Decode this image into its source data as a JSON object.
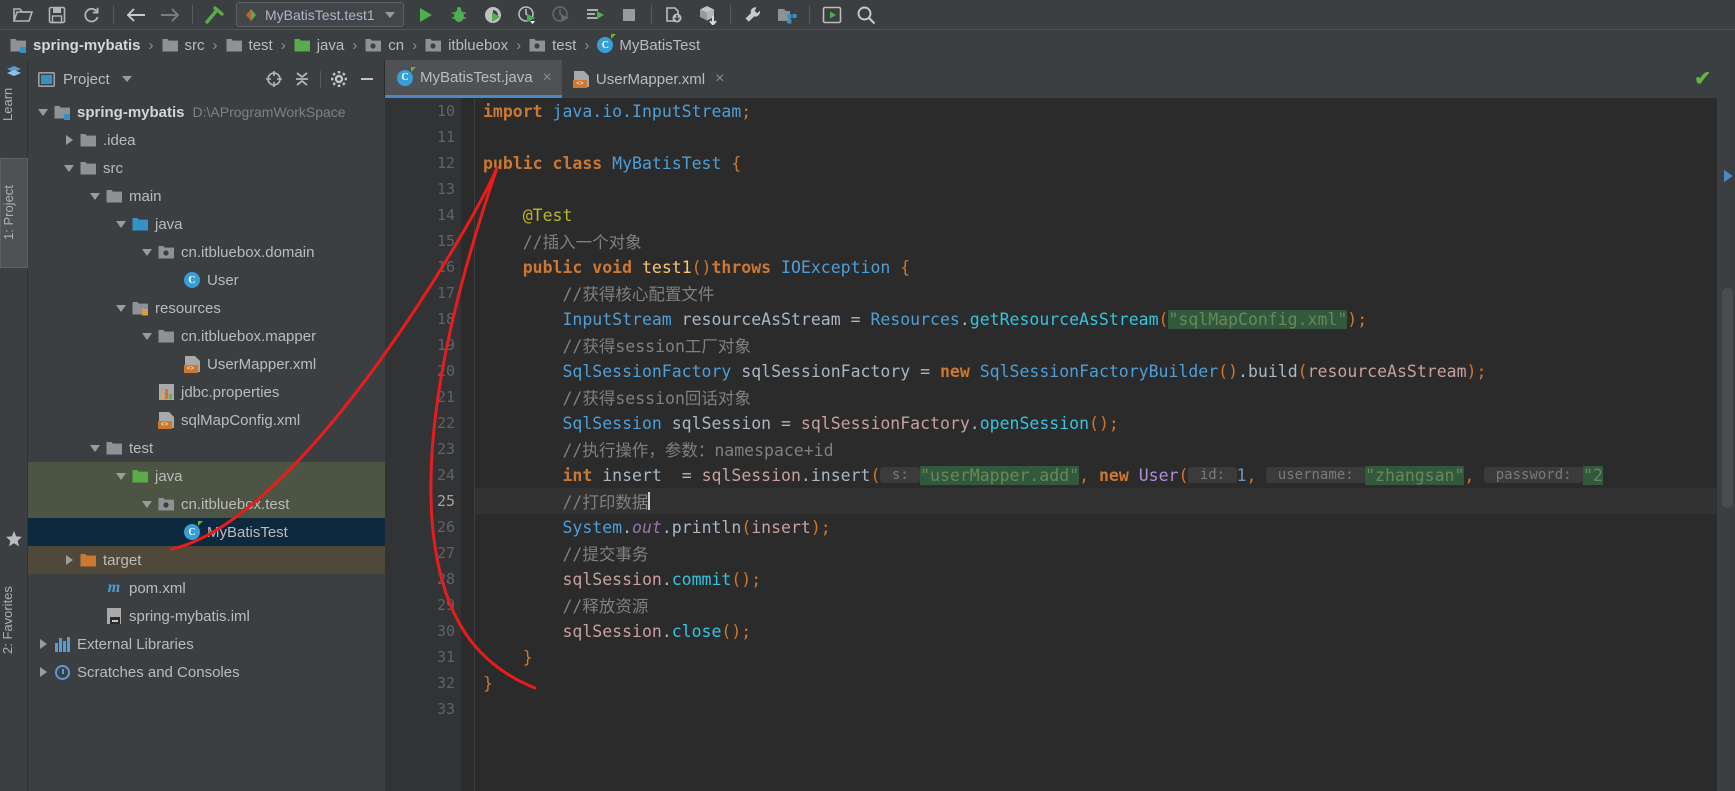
{
  "toolbar": {
    "icons": [
      {
        "name": "open-folder-icon",
        "glyph": "folder-open"
      },
      {
        "name": "save-all-icon",
        "glyph": "floppy"
      },
      {
        "name": "sync-icon",
        "glyph": "refresh"
      },
      {
        "name": "back-icon",
        "glyph": "arrow-left"
      },
      {
        "name": "forward-icon",
        "glyph": "arrow-right"
      },
      {
        "name": "build-hammer-icon",
        "glyph": "hammer"
      }
    ],
    "run_configuration": "MyBatisTest.test1",
    "right_icons": [
      {
        "name": "run-icon",
        "glyph": "play"
      },
      {
        "name": "debug-icon",
        "glyph": "bug"
      },
      {
        "name": "run-with-coverage-icon",
        "glyph": "coverage"
      },
      {
        "name": "profile-icon",
        "glyph": "profiler"
      },
      {
        "name": "attach-profiler-icon",
        "glyph": "profiler-disabled"
      },
      {
        "name": "run-dashboard-icon",
        "glyph": "list-run"
      },
      {
        "name": "stop-icon",
        "glyph": "stop"
      },
      {
        "name": "update-project-icon",
        "glyph": "vcs-update"
      },
      {
        "name": "commit-icon",
        "glyph": "vcs-commit"
      },
      {
        "name": "settings-wrench-icon",
        "glyph": "wrench"
      },
      {
        "name": "project-structure-icon",
        "glyph": "structure"
      },
      {
        "name": "run-anything-icon",
        "glyph": "play-box"
      },
      {
        "name": "search-everywhere-icon",
        "glyph": "magnifier"
      }
    ]
  },
  "breadcrumb": [
    {
      "label": "spring-mybatis",
      "icon": "module-folder-icon",
      "bold": true
    },
    {
      "label": "src",
      "icon": "folder-icon",
      "bold": false
    },
    {
      "label": "test",
      "icon": "folder-icon",
      "bold": false
    },
    {
      "label": "java",
      "icon": "source-root-folder-icon",
      "bold": false
    },
    {
      "label": "cn",
      "icon": "package-icon",
      "bold": false
    },
    {
      "label": "itbluebox",
      "icon": "package-icon",
      "bold": false
    },
    {
      "label": "test",
      "icon": "package-icon",
      "bold": false
    },
    {
      "label": "MyBatisTest",
      "icon": "test-class-icon",
      "bold": false
    }
  ],
  "left_strip": {
    "learn": "Learn",
    "project": "1: Project",
    "favorites": "2: Favorites"
  },
  "project_panel": {
    "title": "Project",
    "header_buttons": [
      {
        "name": "scroll-from-source-icon",
        "glyph": "target"
      },
      {
        "name": "collapse-all-icon",
        "glyph": "collapse"
      },
      {
        "name": "settings-gear-icon",
        "glyph": "gear"
      },
      {
        "name": "hide-panel-icon",
        "glyph": "minus"
      }
    ],
    "tree": [
      {
        "label": "spring-mybatis",
        "path": "D:\\AProgramWorkSpace",
        "indent": 0,
        "arrow": "down",
        "icon": "module-folder-icon",
        "bold": true,
        "selected": ""
      },
      {
        "label": ".idea",
        "path": "",
        "indent": 1,
        "arrow": "right",
        "icon": "folder-icon",
        "bold": false,
        "selected": ""
      },
      {
        "label": "src",
        "path": "",
        "indent": 1,
        "arrow": "down",
        "icon": "folder-icon",
        "bold": false,
        "selected": ""
      },
      {
        "label": "main",
        "path": "",
        "indent": 2,
        "arrow": "down",
        "icon": "folder-icon",
        "bold": false,
        "selected": ""
      },
      {
        "label": "java",
        "path": "",
        "indent": 3,
        "arrow": "down",
        "icon": "source-root-blue-icon",
        "bold": false,
        "selected": ""
      },
      {
        "label": "cn.itbluebox.domain",
        "path": "",
        "indent": 4,
        "arrow": "down",
        "icon": "package-icon",
        "bold": false,
        "selected": ""
      },
      {
        "label": "User",
        "path": "",
        "indent": 5,
        "arrow": "none",
        "icon": "class-icon",
        "bold": false,
        "selected": ""
      },
      {
        "label": "resources",
        "path": "",
        "indent": 3,
        "arrow": "down",
        "icon": "resource-root-folder-icon",
        "bold": false,
        "selected": ""
      },
      {
        "label": "cn.itbluebox.mapper",
        "path": "",
        "indent": 4,
        "arrow": "down",
        "icon": "folder-icon",
        "bold": false,
        "selected": ""
      },
      {
        "label": "UserMapper.xml",
        "path": "",
        "indent": 5,
        "arrow": "none",
        "icon": "xml-file-icon",
        "bold": false,
        "selected": ""
      },
      {
        "label": "jdbc.properties",
        "path": "",
        "indent": 4,
        "arrow": "none",
        "icon": "properties-file-icon",
        "bold": false,
        "selected": ""
      },
      {
        "label": "sqlMapConfig.xml",
        "path": "",
        "indent": 4,
        "arrow": "none",
        "icon": "xml-file-icon",
        "bold": false,
        "selected": ""
      },
      {
        "label": "test",
        "path": "",
        "indent": 2,
        "arrow": "down",
        "icon": "folder-icon",
        "bold": false,
        "selected": ""
      },
      {
        "label": "java",
        "path": "",
        "indent": 3,
        "arrow": "down",
        "icon": "test-source-root-icon",
        "bold": false,
        "selected": "green"
      },
      {
        "label": "cn.itbluebox.test",
        "path": "",
        "indent": 4,
        "arrow": "down",
        "icon": "package-icon",
        "bold": false,
        "selected": "green"
      },
      {
        "label": "MyBatisTest",
        "path": "",
        "indent": 5,
        "arrow": "none",
        "icon": "test-class-icon",
        "bold": false,
        "selected": "blue"
      },
      {
        "label": "target",
        "path": "",
        "indent": 1,
        "arrow": "right",
        "icon": "excluded-folder-icon",
        "bold": false,
        "selected": "olive"
      },
      {
        "label": "pom.xml",
        "path": "",
        "indent": 2,
        "arrow": "none",
        "icon": "maven-file-icon",
        "bold": false,
        "selected": ""
      },
      {
        "label": "spring-mybatis.iml",
        "path": "",
        "indent": 2,
        "arrow": "none",
        "icon": "iml-file-icon",
        "bold": false,
        "selected": ""
      },
      {
        "label": "External Libraries",
        "path": "",
        "indent": 0,
        "arrow": "right",
        "icon": "libraries-icon",
        "bold": false,
        "selected": ""
      },
      {
        "label": "Scratches and Consoles",
        "path": "",
        "indent": 0,
        "arrow": "right",
        "icon": "scratches-icon",
        "bold": false,
        "selected": ""
      }
    ]
  },
  "editor": {
    "tabs": [
      {
        "label": "MyBatisTest.java",
        "icon": "test-class-icon",
        "active": true,
        "close": "×"
      },
      {
        "label": "UserMapper.xml",
        "icon": "xml-file-icon",
        "active": false,
        "close": "×"
      }
    ],
    "first_line_number": 10,
    "current_line": 25,
    "line_numbers": [
      10,
      11,
      12,
      13,
      14,
      15,
      16,
      17,
      18,
      19,
      20,
      21,
      22,
      23,
      24,
      25,
      26,
      27,
      28,
      29,
      30,
      31,
      32,
      33
    ],
    "inspection_status": "✔",
    "code_lines": [
      {
        "n": 10,
        "tokens": [
          {
            "t": "import ",
            "c": "kw"
          },
          {
            "t": "java.io.InputStream",
            "c": "cls"
          },
          {
            "t": ";",
            "c": "sem"
          }
        ]
      },
      {
        "n": 11,
        "tokens": []
      },
      {
        "n": 12,
        "tokens": [
          {
            "t": "public ",
            "c": "kw"
          },
          {
            "t": "class ",
            "c": "kw"
          },
          {
            "t": "MyBatisTest",
            "c": "cls"
          },
          {
            "t": " ",
            "c": "op"
          },
          {
            "t": "{",
            "c": "sem"
          }
        ]
      },
      {
        "n": 13,
        "tokens": []
      },
      {
        "n": 14,
        "tokens": [
          {
            "t": "    @Test",
            "c": "ann"
          }
        ]
      },
      {
        "n": 15,
        "tokens": [
          {
            "t": "    //插入一个对象",
            "c": "cmt"
          }
        ]
      },
      {
        "n": 16,
        "tokens": [
          {
            "t": "    public ",
            "c": "kw"
          },
          {
            "t": "void ",
            "c": "kw"
          },
          {
            "t": "test1",
            "c": "methc"
          },
          {
            "t": "()",
            "c": "sem"
          },
          {
            "t": "throws ",
            "c": "kw"
          },
          {
            "t": "IOException",
            "c": "cls"
          },
          {
            "t": " ",
            "c": "op"
          },
          {
            "t": "{",
            "c": "sem"
          }
        ]
      },
      {
        "n": 17,
        "tokens": [
          {
            "t": "        //获得核心配置文件",
            "c": "cmt"
          }
        ]
      },
      {
        "n": 18,
        "tokens": [
          {
            "t": "        InputStream",
            "c": "cls"
          },
          {
            "t": " resourceAsStream ",
            "c": "var"
          },
          {
            "t": "= ",
            "c": "op"
          },
          {
            "t": "Resources",
            "c": "cls"
          },
          {
            "t": ".",
            "c": "op"
          },
          {
            "t": "getResourceAsStream",
            "c": "meth-i"
          },
          {
            "t": "(",
            "c": "sem"
          },
          {
            "t": "\"sqlMapConfig.xml\"",
            "c": "str-hl"
          },
          {
            "t": ")",
            "c": "sem"
          },
          {
            "t": ";",
            "c": "sem"
          }
        ]
      },
      {
        "n": 19,
        "tokens": [
          {
            "t": "        //获得session工厂对象",
            "c": "cmt"
          }
        ]
      },
      {
        "n": 20,
        "tokens": [
          {
            "t": "        SqlSessionFactory",
            "c": "cls"
          },
          {
            "t": " sqlSessionFactory ",
            "c": "var"
          },
          {
            "t": "= ",
            "c": "op"
          },
          {
            "t": "new ",
            "c": "kw"
          },
          {
            "t": "SqlSessionFactoryBuilder",
            "c": "cls"
          },
          {
            "t": "()",
            "c": "sem"
          },
          {
            "t": ".",
            "c": "op"
          },
          {
            "t": "build",
            "c": "meth"
          },
          {
            "t": "(",
            "c": "sem"
          },
          {
            "t": "resourceAsStream",
            "c": "param"
          },
          {
            "t": ")",
            "c": "sem"
          },
          {
            "t": ";",
            "c": "sem"
          }
        ]
      },
      {
        "n": 21,
        "tokens": [
          {
            "t": "        //获得session回话对象",
            "c": "cmt"
          }
        ]
      },
      {
        "n": 22,
        "tokens": [
          {
            "t": "        SqlSession",
            "c": "cls"
          },
          {
            "t": " sqlSession ",
            "c": "var"
          },
          {
            "t": "= ",
            "c": "op"
          },
          {
            "t": "sqlSessionFactory",
            "c": "param"
          },
          {
            "t": ".",
            "c": "op"
          },
          {
            "t": "openSession",
            "c": "meth-i"
          },
          {
            "t": "()",
            "c": "sem"
          },
          {
            "t": ";",
            "c": "sem"
          }
        ]
      },
      {
        "n": 23,
        "tokens": [
          {
            "t": "        //执行操作，参数：namespace+id",
            "c": "cmt"
          }
        ]
      },
      {
        "n": 24,
        "tokens": [
          {
            "t": "        int ",
            "c": "kw"
          },
          {
            "t": "insert  ",
            "c": "var"
          },
          {
            "t": "= ",
            "c": "op"
          },
          {
            "t": "sqlSession",
            "c": "param"
          },
          {
            "t": ".",
            "c": "op"
          },
          {
            "t": "insert",
            "c": "meth"
          },
          {
            "t": "(",
            "c": "sem"
          },
          {
            "t": " s: ",
            "c": "hint"
          },
          {
            "t": "\"userMapper.add\"",
            "c": "str-hl"
          },
          {
            "t": ", ",
            "c": "sem"
          },
          {
            "t": "new ",
            "c": "kw"
          },
          {
            "t": "User",
            "c": "cls-v"
          },
          {
            "t": "(",
            "c": "sem"
          },
          {
            "t": " id: ",
            "c": "hint"
          },
          {
            "t": "1",
            "c": "num"
          },
          {
            "t": ", ",
            "c": "sem"
          },
          {
            "t": " username: ",
            "c": "hint"
          },
          {
            "t": "\"zhangsan\"",
            "c": "str-hl"
          },
          {
            "t": ", ",
            "c": "sem"
          },
          {
            "t": " password: ",
            "c": "hint"
          },
          {
            "t": "\"2",
            "c": "str-hl"
          }
        ]
      },
      {
        "n": 25,
        "tokens": [
          {
            "t": "        //打印数据",
            "c": "cmt"
          }
        ],
        "caret": true
      },
      {
        "n": 26,
        "tokens": [
          {
            "t": "        System",
            "c": "cls"
          },
          {
            "t": ".",
            "c": "op"
          },
          {
            "t": "out",
            "c": "fld"
          },
          {
            "t": ".",
            "c": "op"
          },
          {
            "t": "println",
            "c": "meth"
          },
          {
            "t": "(",
            "c": "sem"
          },
          {
            "t": "insert",
            "c": "param"
          },
          {
            "t": ")",
            "c": "sem"
          },
          {
            "t": ";",
            "c": "sem"
          }
        ]
      },
      {
        "n": 27,
        "tokens": [
          {
            "t": "        //提交事务",
            "c": "cmt"
          }
        ]
      },
      {
        "n": 28,
        "tokens": [
          {
            "t": "        sqlSession",
            "c": "param"
          },
          {
            "t": ".",
            "c": "op"
          },
          {
            "t": "commit",
            "c": "meth-i"
          },
          {
            "t": "()",
            "c": "sem"
          },
          {
            "t": ";",
            "c": "sem"
          }
        ]
      },
      {
        "n": 29,
        "tokens": [
          {
            "t": "        //释放资源",
            "c": "cmt"
          }
        ]
      },
      {
        "n": 30,
        "tokens": [
          {
            "t": "        sqlSession",
            "c": "param"
          },
          {
            "t": ".",
            "c": "op"
          },
          {
            "t": "close",
            "c": "meth-i"
          },
          {
            "t": "()",
            "c": "sem"
          },
          {
            "t": ";",
            "c": "sem"
          }
        ]
      },
      {
        "n": 31,
        "tokens": [
          {
            "t": "    }",
            "c": "sem"
          }
        ]
      },
      {
        "n": 32,
        "tokens": [
          {
            "t": "}",
            "c": "sem"
          }
        ]
      },
      {
        "n": 33,
        "tokens": []
      }
    ]
  },
  "colors": {
    "background": "#3c3f41",
    "editor_background": "#2b2b2b",
    "gutter_background": "#313335",
    "text": "#a9b7c6",
    "keyword": "#cc7832",
    "string": "#6a8759",
    "number": "#6897bb",
    "comment": "#808080",
    "class_name": "#4e9fd8",
    "annotation": "#bbb529",
    "field": "#9876aa",
    "method_decl": "#ffc66d",
    "selection_blue": "#0d293e",
    "selection_green": "#4c5543",
    "selection_olive": "#50493a",
    "accent_blue": "#4a88c7",
    "annotation_red": "#e81c1c"
  }
}
